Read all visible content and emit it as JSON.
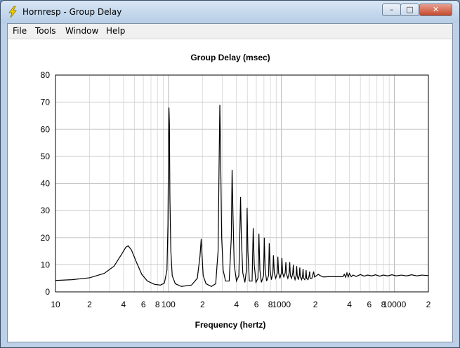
{
  "window": {
    "title": "Hornresp - Group Delay",
    "controls": {
      "minimize": "–",
      "maximize": "□",
      "close": "✕"
    },
    "icon": "lightning-icon"
  },
  "menu": [
    {
      "label": "File"
    },
    {
      "label": "Tools"
    },
    {
      "label": "Window"
    },
    {
      "label": "Help"
    }
  ],
  "chart_data": {
    "type": "line",
    "title": "Group Delay (msec)",
    "xlabel": "Frequency (hertz)",
    "ylabel": "",
    "x_scale": "log",
    "xlim": [
      10,
      20000
    ],
    "ylim": [
      0,
      80
    ],
    "yticks": [
      0,
      10,
      20,
      30,
      40,
      50,
      60,
      70,
      80
    ],
    "ytick_labels": [
      "0",
      "10",
      "20",
      "30",
      "40",
      "50",
      "60",
      "70",
      "80"
    ],
    "xtick_labels": [
      {
        "x": 10,
        "label": "10"
      },
      {
        "x": 20,
        "label": "2"
      },
      {
        "x": 40,
        "label": "4"
      },
      {
        "x": 60,
        "label": "6"
      },
      {
        "x": 80,
        "label": "8"
      },
      {
        "x": 100,
        "label": "100"
      },
      {
        "x": 200,
        "label": "2"
      },
      {
        "x": 400,
        "label": "4"
      },
      {
        "x": 600,
        "label": "6"
      },
      {
        "x": 800,
        "label": "8"
      },
      {
        "x": 1000,
        "label": "1000"
      },
      {
        "x": 2000,
        "label": "2"
      },
      {
        "x": 4000,
        "label": "4"
      },
      {
        "x": 6000,
        "label": "6"
      },
      {
        "x": 8000,
        "label": "8"
      },
      {
        "x": 10000,
        "label": "10000"
      },
      {
        "x": 20000,
        "label": "2"
      }
    ],
    "grid": true,
    "series": [
      {
        "color": "#000000",
        "points": [
          [
            10,
            4.2
          ],
          [
            14,
            4.5
          ],
          [
            20,
            5.2
          ],
          [
            27,
            6.8
          ],
          [
            33,
            9.5
          ],
          [
            38,
            13.5
          ],
          [
            42,
            16.5
          ],
          [
            44,
            17
          ],
          [
            47,
            15.5
          ],
          [
            52,
            11
          ],
          [
            58,
            6.5
          ],
          [
            65,
            4
          ],
          [
            75,
            2.8
          ],
          [
            85,
            2.5
          ],
          [
            92,
            3.2
          ],
          [
            97,
            8
          ],
          [
            99,
            25
          ],
          [
            100,
            50
          ],
          [
            101,
            68
          ],
          [
            102,
            62
          ],
          [
            103,
            35
          ],
          [
            105,
            15
          ],
          [
            108,
            6
          ],
          [
            115,
            3
          ],
          [
            130,
            2
          ],
          [
            160,
            2.5
          ],
          [
            180,
            5
          ],
          [
            190,
            13
          ],
          [
            195,
            19.5
          ],
          [
            198,
            14
          ],
          [
            203,
            6
          ],
          [
            215,
            3
          ],
          [
            240,
            2
          ],
          [
            262,
            3
          ],
          [
            275,
            15
          ],
          [
            280,
            43
          ],
          [
            285,
            69
          ],
          [
            290,
            48
          ],
          [
            296,
            20
          ],
          [
            305,
            8
          ],
          [
            320,
            4
          ],
          [
            345,
            4
          ],
          [
            360,
            20
          ],
          [
            366,
            45
          ],
          [
            372,
            30
          ],
          [
            382,
            10
          ],
          [
            400,
            4
          ],
          [
            420,
            6
          ],
          [
            430,
            25
          ],
          [
            435,
            35
          ],
          [
            442,
            20
          ],
          [
            455,
            7
          ],
          [
            475,
            3.5
          ],
          [
            490,
            8
          ],
          [
            497,
            31
          ],
          [
            505,
            15
          ],
          [
            520,
            4
          ],
          [
            550,
            4
          ],
          [
            563,
            23.5
          ],
          [
            575,
            10
          ],
          [
            595,
            3.5
          ],
          [
            620,
            5
          ],
          [
            632,
            21.5
          ],
          [
            645,
            8
          ],
          [
            665,
            3.5
          ],
          [
            695,
            6
          ],
          [
            705,
            20
          ],
          [
            718,
            8
          ],
          [
            740,
            4
          ],
          [
            770,
            6
          ],
          [
            780,
            18
          ],
          [
            795,
            8
          ],
          [
            815,
            4.5
          ],
          [
            840,
            7
          ],
          [
            850,
            13.5
          ],
          [
            865,
            7
          ],
          [
            890,
            5
          ],
          [
            920,
            7
          ],
          [
            930,
            13
          ],
          [
            945,
            7
          ],
          [
            970,
            5
          ],
          [
            1000,
            7
          ],
          [
            1010,
            12.5
          ],
          [
            1025,
            7
          ],
          [
            1050,
            5.5
          ],
          [
            1080,
            7
          ],
          [
            1095,
            11
          ],
          [
            1110,
            6.5
          ],
          [
            1140,
            5
          ],
          [
            1170,
            7
          ],
          [
            1185,
            11
          ],
          [
            1200,
            6
          ],
          [
            1230,
            5
          ],
          [
            1260,
            7
          ],
          [
            1275,
            10
          ],
          [
            1290,
            6
          ],
          [
            1320,
            4.5
          ],
          [
            1350,
            6
          ],
          [
            1365,
            9.5
          ],
          [
            1380,
            6
          ],
          [
            1410,
            4.5
          ],
          [
            1440,
            6
          ],
          [
            1455,
            9
          ],
          [
            1470,
            5.5
          ],
          [
            1510,
            4.5
          ],
          [
            1540,
            6
          ],
          [
            1555,
            8.5
          ],
          [
            1570,
            5
          ],
          [
            1610,
            4.5
          ],
          [
            1640,
            6
          ],
          [
            1655,
            8
          ],
          [
            1670,
            5
          ],
          [
            1720,
            4.5
          ],
          [
            1760,
            6
          ],
          [
            1775,
            7.5
          ],
          [
            1795,
            5
          ],
          [
            1860,
            5
          ],
          [
            1900,
            6.5
          ],
          [
            1930,
            7.5
          ],
          [
            1960,
            5.5
          ],
          [
            2050,
            6
          ],
          [
            2120,
            6.5
          ],
          [
            2200,
            6
          ],
          [
            2350,
            5.5
          ],
          [
            2600,
            5.6
          ],
          [
            3000,
            5.6
          ],
          [
            3500,
            5.6
          ],
          [
            3600,
            6.5
          ],
          [
            3700,
            5.4
          ],
          [
            3800,
            7
          ],
          [
            3900,
            5.5
          ],
          [
            4000,
            6.8
          ],
          [
            4150,
            5.6
          ],
          [
            4300,
            6.2
          ],
          [
            4600,
            5.7
          ],
          [
            5000,
            6.4
          ],
          [
            5400,
            5.8
          ],
          [
            5800,
            6.2
          ],
          [
            6300,
            5.9
          ],
          [
            6800,
            6.3
          ],
          [
            7400,
            5.8
          ],
          [
            8000,
            6.2
          ],
          [
            8700,
            5.9
          ],
          [
            9500,
            6.3
          ],
          [
            10400,
            5.9
          ],
          [
            11500,
            6.2
          ],
          [
            12800,
            5.9
          ],
          [
            14200,
            6.3
          ],
          [
            15800,
            5.9
          ],
          [
            17500,
            6.2
          ],
          [
            20000,
            6
          ]
        ]
      }
    ]
  }
}
